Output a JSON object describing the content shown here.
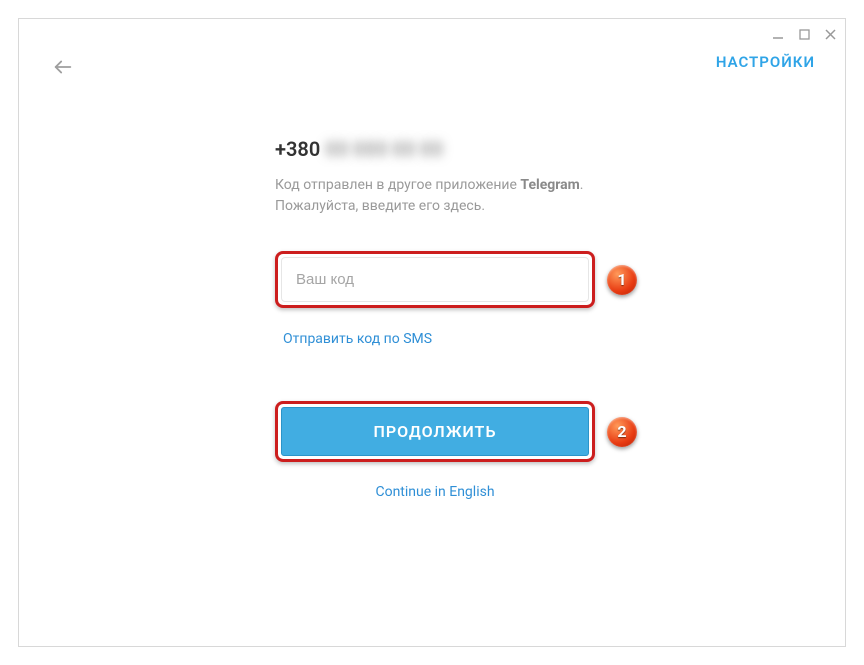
{
  "window": {
    "settings_label": "НАСТРОЙКИ"
  },
  "phone": {
    "prefix": "+380",
    "hidden": "00 000 00 00"
  },
  "hint": {
    "line1_pre": "Код отправлен в другое приложение ",
    "line1_bold": "Telegram",
    "line1_post": ".",
    "line2": "Пожалуйста, введите его здесь."
  },
  "code_input": {
    "placeholder": "Ваш код",
    "value": ""
  },
  "sms_link": "Отправить код по SMS",
  "continue_label": "ПРОДОЛЖИТЬ",
  "english_link": "Continue in English",
  "markers": {
    "one": "1",
    "two": "2"
  }
}
